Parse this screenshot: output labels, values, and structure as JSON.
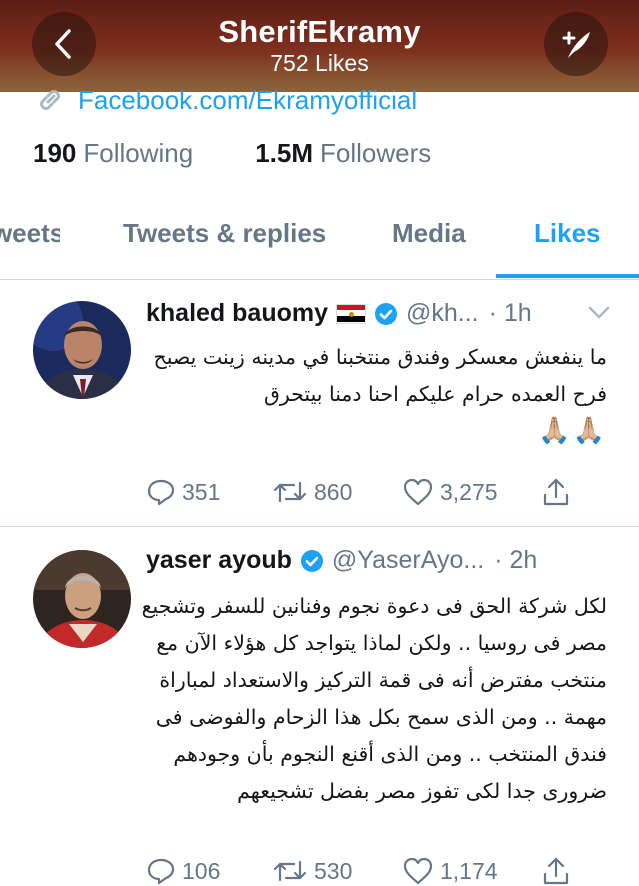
{
  "header": {
    "title": "SherifEkramy",
    "subtitle": "752 Likes"
  },
  "profile": {
    "link": "Facebook.com/Ekramyofficial",
    "following_count": "190",
    "following_label": "Following",
    "followers_count": "1.5M",
    "followers_label": "Followers"
  },
  "tabs": [
    {
      "label": "Tweets"
    },
    {
      "label": "Tweets & replies"
    },
    {
      "label": "Media"
    },
    {
      "label": "Likes",
      "active": true
    }
  ],
  "tweets": [
    {
      "name": "khaled bauomy",
      "handle": "@kh...",
      "time": "· 1h",
      "body": "ما ينفعش معسكر وفندق منتخبنا في مدينه زينت يصبح فرح العمده حرام عليكم احنا دمنا بيتحرق",
      "emoji": "🙏🏼🙏🏼",
      "replies": "351",
      "retweets": "860",
      "likes": "3,275"
    },
    {
      "name": "yaser ayoub",
      "handle": "@YaserAyo...",
      "time": "· 2h",
      "body": "لكل شركة الحق فى دعوة نجوم وفنانين للسفر وتشجيع مصر فى روسيا .. ولكن لماذا يتواجد كل هؤلاء الآن مع منتخب مفترض أنه فى قمة التركيز والاستعداد لمباراة مهمة .. ومن الذى سمح بكل هذا الزحام والفوضى فى فندق المنتخب .. ومن الذى أقنع النجوم بأن وجودهم ضرورى جدا لكى تفوز مصر بفضل تشجيعهم",
      "replies": "106",
      "retweets": "530",
      "likes": "1,174"
    }
  ],
  "colors": {
    "accent": "#1da1f2",
    "muted": "#657786",
    "text": "#14171a"
  }
}
